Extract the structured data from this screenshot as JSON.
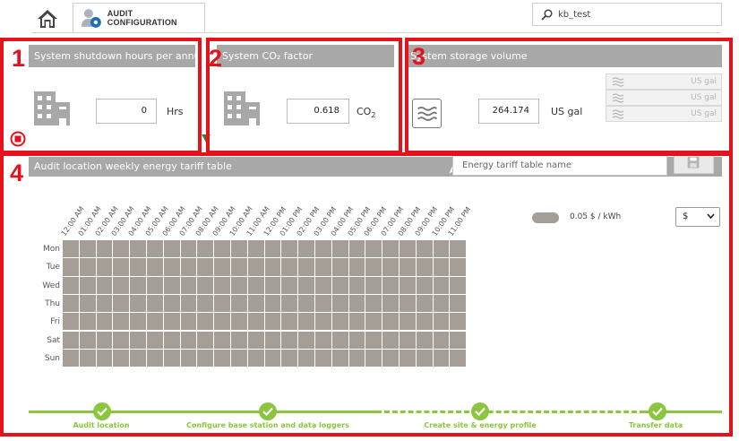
{
  "topbar": {
    "tab_label": "AUDIT CONFIGURATION",
    "search_value": "kb_test"
  },
  "annotations": [
    "1",
    "2",
    "3",
    "4"
  ],
  "shutdown": {
    "title": "System shutdown hours per annum",
    "value": "0",
    "unit": "Hrs"
  },
  "co2": {
    "title": "System CO₂ factor",
    "value": "0.618",
    "unit": "CO",
    "unit_sub": "2"
  },
  "storage": {
    "title": "System storage volume",
    "value": "264.174",
    "unit": "US gal",
    "rows": [
      {
        "unit": "US gal"
      },
      {
        "unit": "US gal"
      },
      {
        "unit": "US gal"
      }
    ]
  },
  "tariff": {
    "title": "Audit location weekly energy tariff table",
    "name_placeholder": "Energy tariff table name",
    "hours": [
      "12:00 AM",
      "01:00 AM",
      "02:00 AM",
      "03:00 AM",
      "04:00 AM",
      "05:00 AM",
      "06:00 AM",
      "07:00 AM",
      "08:00 AM",
      "09:00 AM",
      "10:00 AM",
      "11:00 AM",
      "12:00 PM",
      "01:00 PM",
      "02:00 PM",
      "03:00 PM",
      "04:00 PM",
      "05:00 PM",
      "06:00 PM",
      "07:00 PM",
      "08:00 PM",
      "09:00 PM",
      "10:00 PM",
      "11:00 PM"
    ],
    "days": [
      "Mon",
      "Tue",
      "Wed",
      "Thu",
      "Fri",
      "Sat",
      "Sun"
    ],
    "legend": "0.05 $ / kWh",
    "currency": "$"
  },
  "steps": [
    {
      "label": "Audit location"
    },
    {
      "label": "Configure base station and data loggers"
    },
    {
      "label": "Create site & energy profile"
    },
    {
      "label": "Transfer data"
    }
  ],
  "colors": {
    "accent_red": "#e3121b",
    "panel_gray": "#a8a8a8",
    "cell_fill": "#a59e96",
    "step_green": "#8cc63f"
  }
}
